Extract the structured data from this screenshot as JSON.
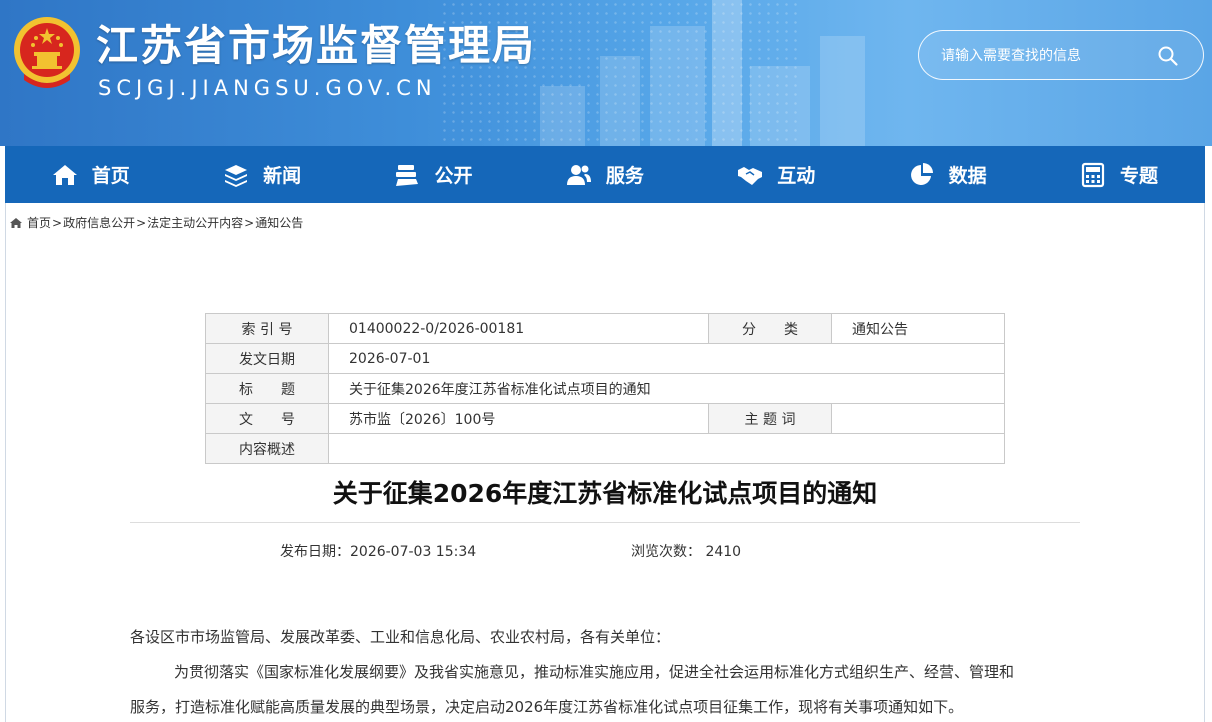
{
  "header": {
    "title": "江苏省市场监督管理局",
    "domain": "SCJGJ.JIANGSU.GOV.CN",
    "search_placeholder": "请输入需要查找的信息"
  },
  "nav": [
    {
      "label": "首页",
      "icon": "home-icon"
    },
    {
      "label": "新闻",
      "icon": "layers-icon"
    },
    {
      "label": "公开",
      "icon": "document-stack-icon"
    },
    {
      "label": "服务",
      "icon": "users-icon"
    },
    {
      "label": "互动",
      "icon": "handshake-icon"
    },
    {
      "label": "数据",
      "icon": "pie-chart-icon"
    },
    {
      "label": "专题",
      "icon": "calculator-icon"
    }
  ],
  "breadcrumb": [
    "首页",
    "政府信息公开",
    "法定主动公开内容",
    "通知公告"
  ],
  "meta": {
    "index_label": "索 引 号",
    "index_value": "01400022-0/2026-00181",
    "category_label": "分　　类",
    "category_value": "通知公告",
    "date_label": "发文日期",
    "date_value": "2026-07-01",
    "title_label": "标　　题",
    "title_value": "关于征集2026年度江苏省标准化试点项目的通知",
    "docno_label": "文　　号",
    "docno_value": "苏市监〔2026〕100号",
    "subject_label": "主 题 词",
    "subject_value": "",
    "summary_label": "内容概述",
    "summary_value": ""
  },
  "article": {
    "title": "关于征集2026年度江苏省标准化试点项目的通知",
    "publish_label": "发布日期：",
    "publish_value": "2026-07-03 15:34",
    "views_label": "浏览次数：",
    "views_value": "2410",
    "salutation": "各设区市市场监管局、发展改革委、工业和信息化局、农业农村局，各有关单位：",
    "para1_line1": "为贯彻落实《国家标准化发展纲要》及我省实施意见，推动标准实施应用，促进全社会运用标准化方式组织生产、经营、管理和",
    "para1_line2": "服务，打造标准化赋能高质量发展的典型场景，决定启动2026年度江苏省标准化试点项目征集工作，现将有关事项通知如下。"
  },
  "colors": {
    "nav_bg": "#1567b9",
    "header_bg": "#3f8fda"
  }
}
